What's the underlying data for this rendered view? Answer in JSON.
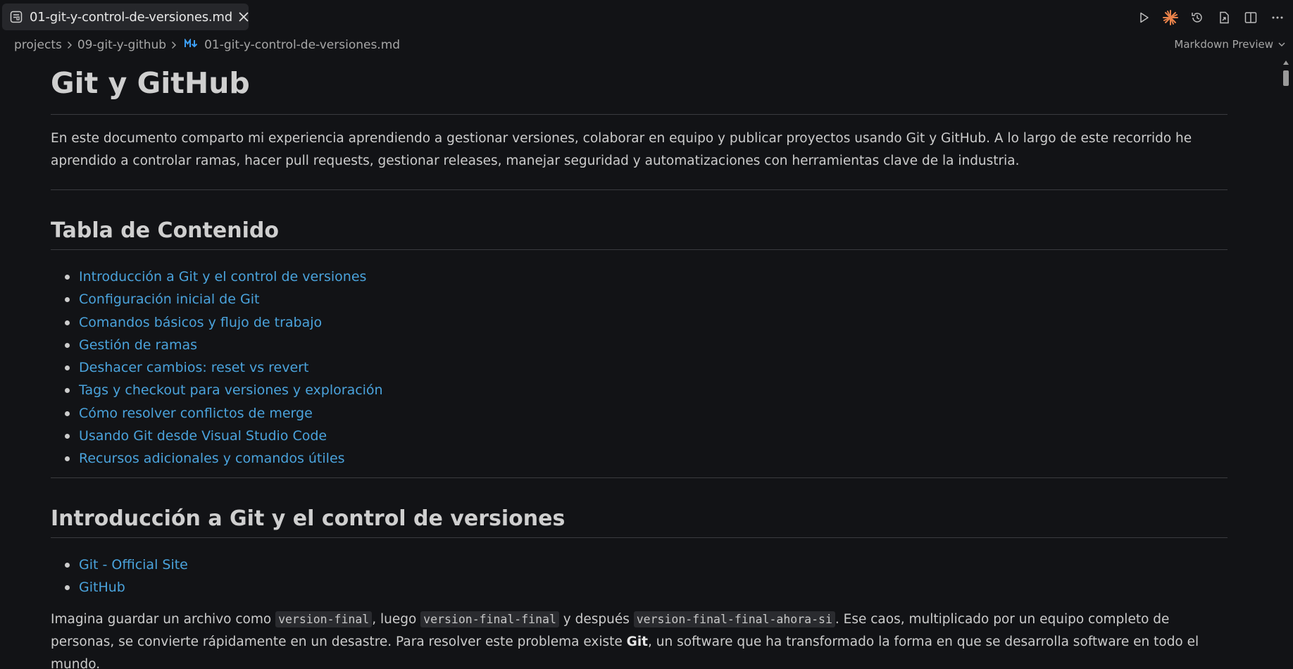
{
  "tab": {
    "title": "01-git-y-control-de-versiones.md"
  },
  "breadcrumb": {
    "items": [
      "projects",
      "09-git-y-github",
      "01-git-y-control-de-versiones.md"
    ],
    "preview_label": "Markdown Preview"
  },
  "icons": {
    "tab": "preview-icon",
    "close": "close-icon",
    "run": "play-icon",
    "ai": "sparkle-icon",
    "timeline": "history-icon",
    "open_source": "open-source-icon",
    "split": "split-editor-icon",
    "more": "more-actions-icon",
    "markdown": "markdown-icon"
  },
  "colors": {
    "background": "#121316",
    "link": "#4aa3dc",
    "accent_sparkle": "#e8824a",
    "markdown_icon": "#3c9ef5"
  },
  "doc": {
    "h1": "Git y GitHub",
    "intro": "En este documento comparto mi experiencia aprendiendo a gestionar versiones, colaborar en equipo y publicar proyectos usando Git y GitHub. A lo largo de este recorrido he aprendido a controlar ramas, hacer pull requests, gestionar releases, manejar seguridad y automatizaciones con herramientas clave de la industria.",
    "toc_heading": "Tabla de Contenido",
    "toc": [
      "Introducción a Git y el control de versiones",
      "Configuración inicial de Git",
      "Comandos básicos y flujo de trabajo",
      "Gestión de ramas",
      "Deshacer cambios: reset vs revert",
      "Tags y checkout para versiones y exploración",
      "Cómo resolver conflictos de merge",
      "Usando Git desde Visual Studio Code",
      "Recursos adicionales y comandos útiles"
    ],
    "section1_heading": "Introducción a Git y el control de versiones",
    "section1_links": [
      "Git - Official Site",
      "GitHub"
    ],
    "para": {
      "t1": "Imagina guardar un archivo como ",
      "c1": "version-final",
      "t2": ", luego ",
      "c2": "version-final-final",
      "t3": " y después ",
      "c3": "version-final-final-ahora-si",
      "t4": ". Ese caos, multiplicado por un equipo completo de personas, se convierte rápidamente en un desastre. Para resolver este problema existe ",
      "b1": "Git",
      "t5": ", un software que ha transformado la forma en que se desarrolla software en todo el mundo."
    }
  }
}
